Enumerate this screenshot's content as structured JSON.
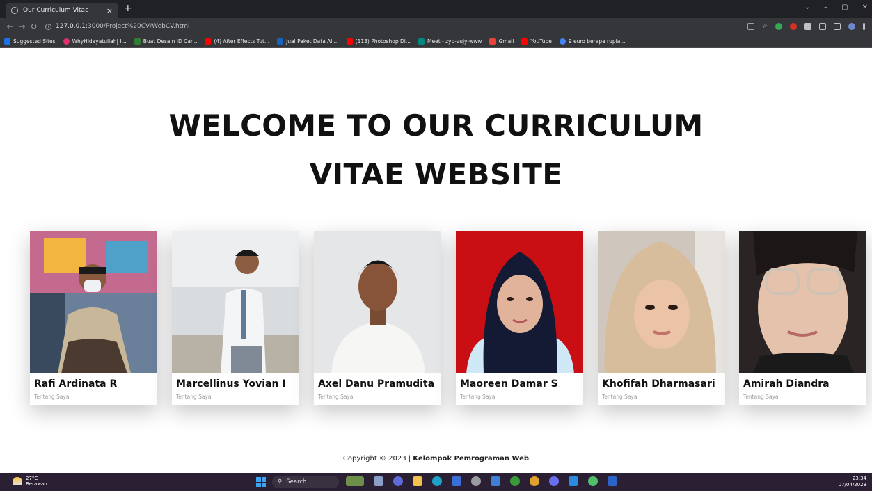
{
  "browser": {
    "tab_title": "Our Curriculum Vitae",
    "tab_close": "×",
    "new_tab": "+",
    "url_host": "127.0.0.1",
    "url_rest": ":3000/Project%20CV/WebCV.html",
    "window_controls": [
      "⌄",
      "–",
      "▢",
      "✕"
    ],
    "bookmarks": [
      {
        "label": "Suggested Sites",
        "color": "#1a73e8"
      },
      {
        "label": "WhyHidayatullah| I...",
        "color": "#e1306c"
      },
      {
        "label": "Buat Desain ID Car...",
        "color": "#2e7d32"
      },
      {
        "label": "(4) After Effects Tut...",
        "color": "#ff0000"
      },
      {
        "label": "Jual Paket Data All...",
        "color": "#1565c0"
      },
      {
        "label": "(113) Photoshop Di...",
        "color": "#ff0000"
      },
      {
        "label": "Meet - zyp-vujy-www",
        "color": "#00897b"
      },
      {
        "label": "Gmail",
        "color": "#ea4335"
      },
      {
        "label": "YouTube",
        "color": "#ff0000"
      },
      {
        "label": "9 euro berapa rupia...",
        "color": "#4285f4"
      }
    ]
  },
  "page": {
    "heading": "WELCOME TO OUR CURRICULUM VITAE WEBSITE",
    "members": [
      {
        "name": "Rafi Ardinata R",
        "subtitle": "Tentang Saya"
      },
      {
        "name": "Marcellinus Yovian I",
        "subtitle": "Tentang Saya"
      },
      {
        "name": "Axel Danu Pramudita",
        "subtitle": "Tentang Saya"
      },
      {
        "name": "Maoreen Damar S",
        "subtitle": "Tentang Saya"
      },
      {
        "name": "Khofifah Dharmasari",
        "subtitle": "Tentang Saya"
      },
      {
        "name": "Amirah Diandra",
        "subtitle": "Tentang Saya"
      }
    ],
    "footer_prefix": "Copyright © 2023 | ",
    "footer_bold": "Kelompok Pemrograman Web"
  },
  "taskbar": {
    "temperature": "27°C",
    "weather": "Berawan",
    "search_label": "Search",
    "time": "23:34",
    "date": "07/04/2023"
  }
}
